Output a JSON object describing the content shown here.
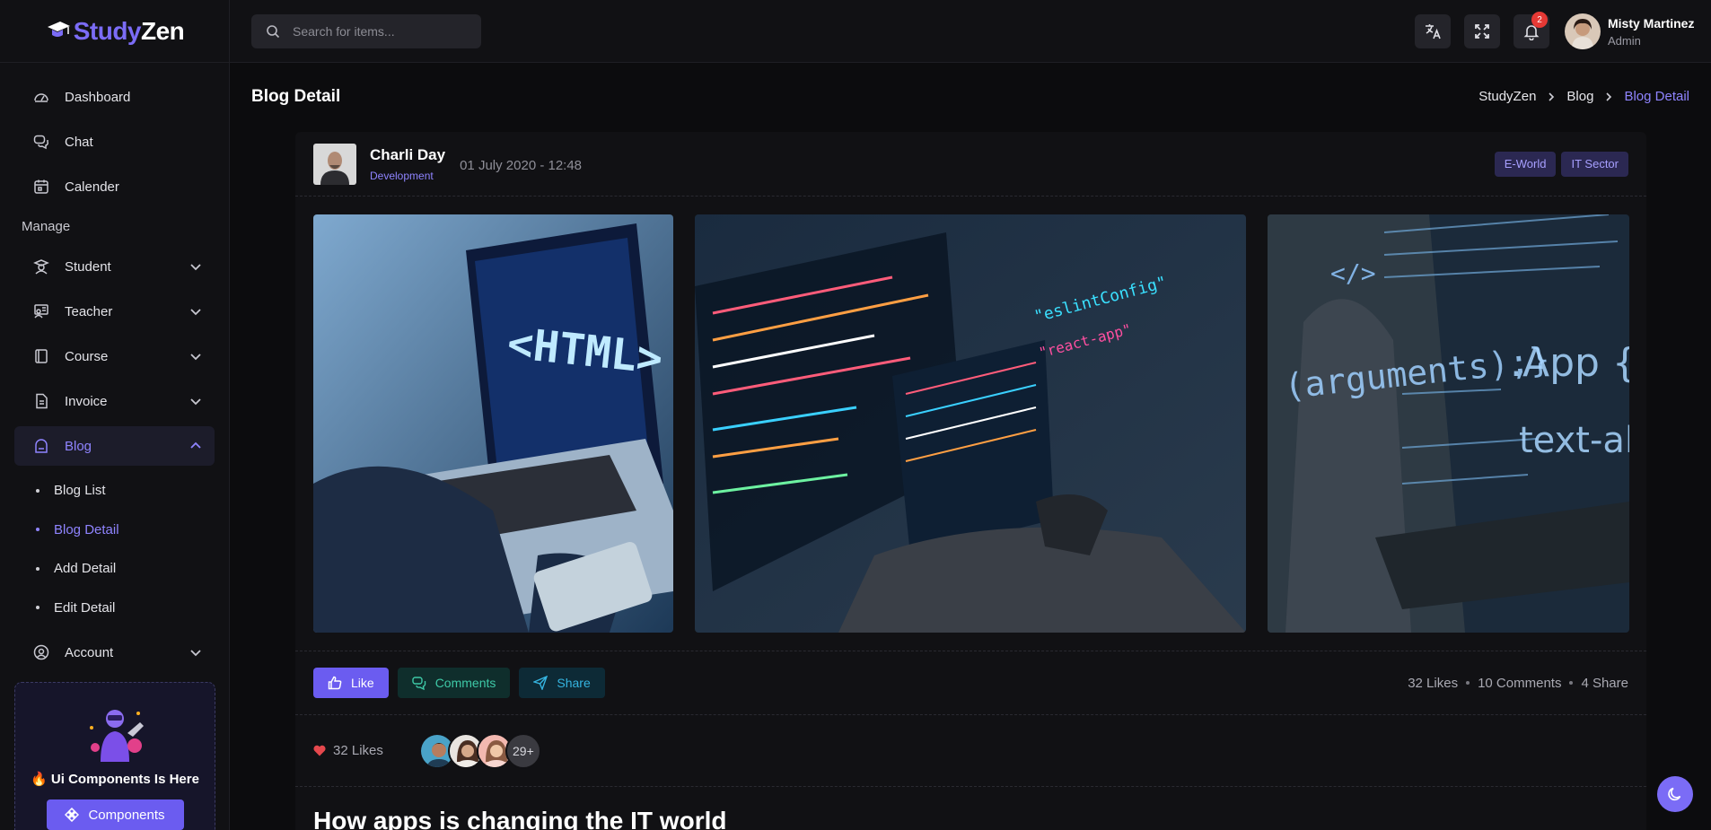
{
  "app": {
    "logo_part1": "Study",
    "logo_part2": "Zen"
  },
  "search": {
    "placeholder": "Search for items..."
  },
  "topbar": {
    "notification_count": "2",
    "user_name": "Misty Martinez",
    "user_role": "Admin"
  },
  "sidebar": {
    "items_top": [
      {
        "label": "Dashboard",
        "icon": "dashboard-icon"
      },
      {
        "label": "Chat",
        "icon": "chat-icon"
      },
      {
        "label": "Calender",
        "icon": "calendar-icon"
      }
    ],
    "section_label": "Manage",
    "items_manage": [
      {
        "label": "Student",
        "icon": "student-icon"
      },
      {
        "label": "Teacher",
        "icon": "teacher-icon"
      },
      {
        "label": "Course",
        "icon": "course-icon"
      },
      {
        "label": "Invoice",
        "icon": "invoice-icon"
      },
      {
        "label": "Blog",
        "icon": "blog-icon",
        "active": true
      }
    ],
    "blog_sub": [
      {
        "label": "Blog List"
      },
      {
        "label": "Blog Detail",
        "active": true
      },
      {
        "label": "Add Detail"
      },
      {
        "label": "Edit Detail"
      }
    ],
    "account": {
      "label": "Account",
      "icon": "account-icon"
    },
    "promo": {
      "text": "Ui Components Is Here",
      "button": "Components"
    }
  },
  "page": {
    "title": "Blog Detail",
    "breadcrumb": [
      "StudyZen",
      "Blog",
      "Blog Detail"
    ]
  },
  "post": {
    "author": "Charli Day",
    "category": "Development",
    "date": "01 July 2020 - 12:48",
    "tags": [
      "E-World",
      "IT Sector"
    ],
    "actions": {
      "like": "Like",
      "comments": "Comments",
      "share": "Share"
    },
    "stats": {
      "likes": "32 Likes",
      "comments": "10 Comments",
      "shares": "4 Share"
    },
    "likes_summary": "32 Likes",
    "more_likers": "29+",
    "title": "How apps is changing the IT world"
  },
  "colors": {
    "accent": "#7b6cf6",
    "background": "#0c0c0e",
    "panel": "#111114",
    "comments": "#3ec9a7",
    "share": "#35b4e0",
    "heart": "#e5484d"
  }
}
